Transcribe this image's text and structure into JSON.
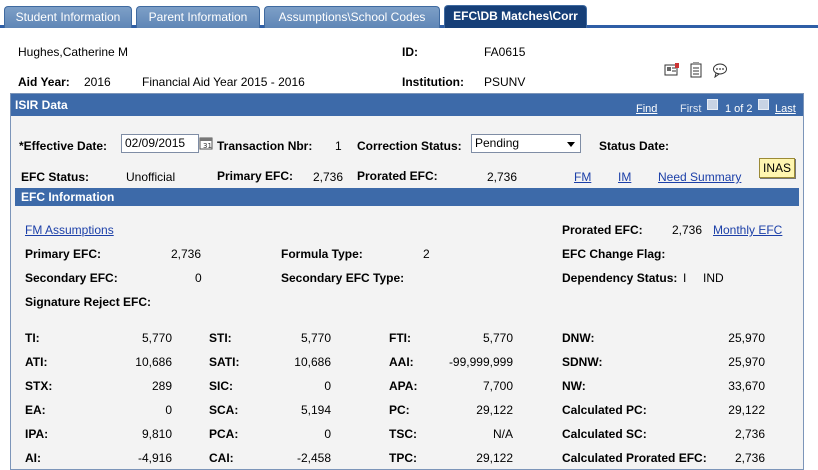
{
  "tabs": [
    {
      "label": "Student Information"
    },
    {
      "label": "Parent Information"
    },
    {
      "label": "Assumptions\\School Codes"
    },
    {
      "label": "EFC\\DB Matches\\Corr"
    }
  ],
  "header": {
    "student_name": "Hughes,Catherine M",
    "id_label": "ID:",
    "id_value": "FA0615",
    "aid_year_label": "Aid Year:",
    "aid_year_value": "2016",
    "aid_year_desc": "Financial Aid Year 2015 - 2016",
    "institution_label": "Institution:",
    "institution_value": "PSUNV"
  },
  "isir": {
    "title": "ISIR Data",
    "find": "Find",
    "first": "First",
    "page": "1 of 2",
    "last": "Last"
  },
  "form": {
    "effective_date_label": "*Effective Date:",
    "effective_date_value": "02/09/2015",
    "transaction_label": "Transaction Nbr:",
    "transaction_value": "1",
    "correction_label": "Correction Status:",
    "correction_value": "Pending",
    "status_date_label": "Status Date:",
    "efc_status_label": "EFC Status:",
    "efc_status_value": "Unofficial",
    "primary_efc_label": "Primary EFC:",
    "primary_efc_value": "2,736",
    "prorated_efc_label": "Prorated EFC:",
    "prorated_efc_value": "2,736",
    "fm_link": "FM",
    "im_link": "IM",
    "need_summary_link": "Need Summary",
    "inas_button": "INAS"
  },
  "efc_info": {
    "title": "EFC Information",
    "fm_assumptions": "FM Assumptions",
    "prorated_label": "Prorated EFC:",
    "prorated_value": "2,736",
    "monthly_efc": "Monthly EFC",
    "primary_label": "Primary EFC:",
    "primary_value": "2,736",
    "formula_label": "Formula Type:",
    "formula_value": "2",
    "change_flag_label": "EFC Change Flag:",
    "secondary_label": "Secondary EFC:",
    "secondary_value": "0",
    "secondary_type_label": "Secondary EFC Type:",
    "dependency_label": "Dependency Status:",
    "dependency_code": "I",
    "dependency_value": "IND",
    "signature_label": "Signature Reject EFC:"
  },
  "grid": {
    "col1": [
      {
        "label": "TI:",
        "value": "5,770"
      },
      {
        "label": "ATI:",
        "value": "10,686"
      },
      {
        "label": "STX:",
        "value": "289"
      },
      {
        "label": "EA:",
        "value": "0"
      },
      {
        "label": "IPA:",
        "value": "9,810"
      },
      {
        "label": "AI:",
        "value": "-4,916"
      }
    ],
    "col2": [
      {
        "label": "STI:",
        "value": "5,770"
      },
      {
        "label": "SATI:",
        "value": "10,686"
      },
      {
        "label": "SIC:",
        "value": "0"
      },
      {
        "label": "SCA:",
        "value": "5,194"
      },
      {
        "label": "PCA:",
        "value": "0"
      },
      {
        "label": "CAI:",
        "value": "-2,458"
      }
    ],
    "col3": [
      {
        "label": "FTI:",
        "value": "5,770"
      },
      {
        "label": "AAI:",
        "value": "-99,999,999"
      },
      {
        "label": "APA:",
        "value": "7,700"
      },
      {
        "label": "PC:",
        "value": "29,122"
      },
      {
        "label": "TSC:",
        "value": "N/A"
      },
      {
        "label": "TPC:",
        "value": "29,122"
      }
    ],
    "col4": [
      {
        "label": "DNW:",
        "value": "25,970"
      },
      {
        "label": "SDNW:",
        "value": "25,970"
      },
      {
        "label": "NW:",
        "value": "33,670"
      },
      {
        "label": "Calculated PC:",
        "value": "29,122"
      },
      {
        "label": "Calculated SC:",
        "value": "2,736"
      },
      {
        "label": "Calculated Prorated EFC:",
        "value": "2,736"
      }
    ]
  }
}
